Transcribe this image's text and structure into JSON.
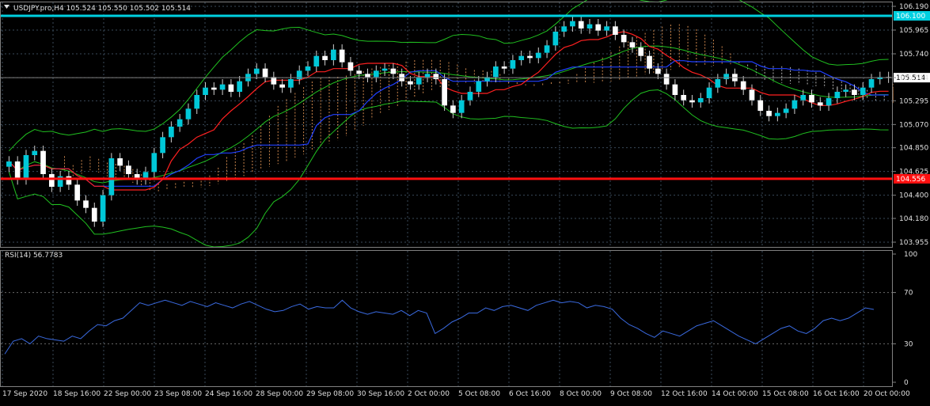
{
  "header": {
    "symbol_line": "USDJPY.pro,H4  105.524 105.550 105.502 105.514",
    "rsi_label": "RSI(14) 56.7783"
  },
  "colors": {
    "background": "#000000",
    "grid": "#3a4a5a",
    "bull_candle": "#00c8d8",
    "bear_candle": "#ffffff",
    "tenkan": "#ff2020",
    "kijun": "#2040ff",
    "bollinger": "#20c020",
    "cloud_a": "#ffa860",
    "cloud_b": "#e0e0e0",
    "resistance": "#00d0e0",
    "support": "#ff1010",
    "rsi_line": "#3a6ae0",
    "text": "#e0e0e0"
  },
  "chart_data": [
    {
      "type": "candlestick",
      "title": "USDJPY.pro,H4",
      "ylim": [
        103.955,
        106.19
      ],
      "y_ticks": [
        "106.190",
        "105.965",
        "105.740",
        "105.514",
        "105.295",
        "105.070",
        "104.850",
        "104.625",
        "104.400",
        "104.180",
        "103.955"
      ],
      "x_ticks": [
        "17 Sep 2020",
        "18 Sep 16:00",
        "22 Sep 00:00",
        "23 Sep 08:00",
        "24 Sep 16:00",
        "28 Sep 00:00",
        "29 Sep 08:00",
        "30 Sep 16:00",
        "2 Oct 00:00",
        "5 Oct 08:00",
        "6 Oct 16:00",
        "8 Oct 00:00",
        "9 Oct 08:00",
        "12 Oct 16:00",
        "14 Oct 00:00",
        "15 Oct 08:00",
        "16 Oct 16:00",
        "20 Oct 00:00"
      ],
      "current_price": "105.514",
      "horizontal_lines": [
        {
          "label": "106.100",
          "value": 106.1,
          "color": "#00d0e0"
        },
        {
          "label": "104.556",
          "value": 104.556,
          "color": "#ff1010"
        }
      ],
      "closes": [
        104.72,
        104.55,
        104.78,
        104.82,
        104.6,
        104.48,
        104.58,
        104.5,
        104.35,
        104.28,
        104.15,
        104.4,
        104.75,
        104.68,
        104.6,
        104.55,
        104.62,
        104.8,
        104.95,
        105.05,
        105.12,
        105.22,
        105.35,
        105.42,
        105.4,
        105.45,
        105.38,
        105.48,
        105.55,
        105.6,
        105.52,
        105.45,
        105.42,
        105.5,
        105.58,
        105.62,
        105.72,
        105.68,
        105.78,
        105.66,
        105.58,
        105.55,
        105.52,
        105.58,
        105.6,
        105.55,
        105.48,
        105.45,
        105.52,
        105.55,
        105.5,
        105.25,
        105.18,
        105.3,
        105.38,
        105.48,
        105.52,
        105.62,
        105.6,
        105.68,
        105.72,
        105.7,
        105.75,
        105.82,
        105.95,
        106.0,
        106.05,
        105.98,
        106.02,
        105.96,
        106.0,
        105.92,
        105.85,
        105.8,
        105.72,
        105.6,
        105.55,
        105.45,
        105.35,
        105.3,
        105.28,
        105.32,
        105.42,
        105.5,
        105.55,
        105.48,
        105.4,
        105.3,
        105.2,
        105.15,
        105.18,
        105.22,
        105.3,
        105.35,
        105.28,
        105.25,
        105.32,
        105.38,
        105.4,
        105.35,
        105.42,
        105.5,
        105.52,
        105.514
      ],
      "series": [
        {
          "name": "RSI(14)",
          "ylim": [
            0,
            100
          ],
          "y_ticks": [
            "100",
            "70",
            "30",
            "0"
          ],
          "last": 56.7783,
          "values": [
            22,
            32,
            34,
            30,
            36,
            34,
            33,
            32,
            36,
            34,
            40,
            45,
            44,
            48,
            50,
            56,
            62,
            60,
            62,
            64,
            62,
            60,
            63,
            61,
            59,
            62,
            60,
            58,
            61,
            63,
            60,
            57,
            55,
            56,
            59,
            61,
            57,
            59,
            58,
            58,
            64,
            58,
            55,
            53,
            55,
            54,
            53,
            56,
            52,
            56,
            54,
            38,
            42,
            47,
            50,
            54,
            54,
            58,
            56,
            59,
            60,
            58,
            56,
            60,
            62,
            64,
            62,
            63,
            62,
            58,
            60,
            59,
            57,
            50,
            45,
            42,
            38,
            35,
            40,
            38,
            36,
            40,
            44,
            46,
            48,
            44,
            40,
            36,
            33,
            30,
            34,
            38,
            42,
            44,
            40,
            38,
            42,
            48,
            50,
            48,
            50,
            54,
            58,
            56.7783
          ]
        }
      ]
    }
  ]
}
